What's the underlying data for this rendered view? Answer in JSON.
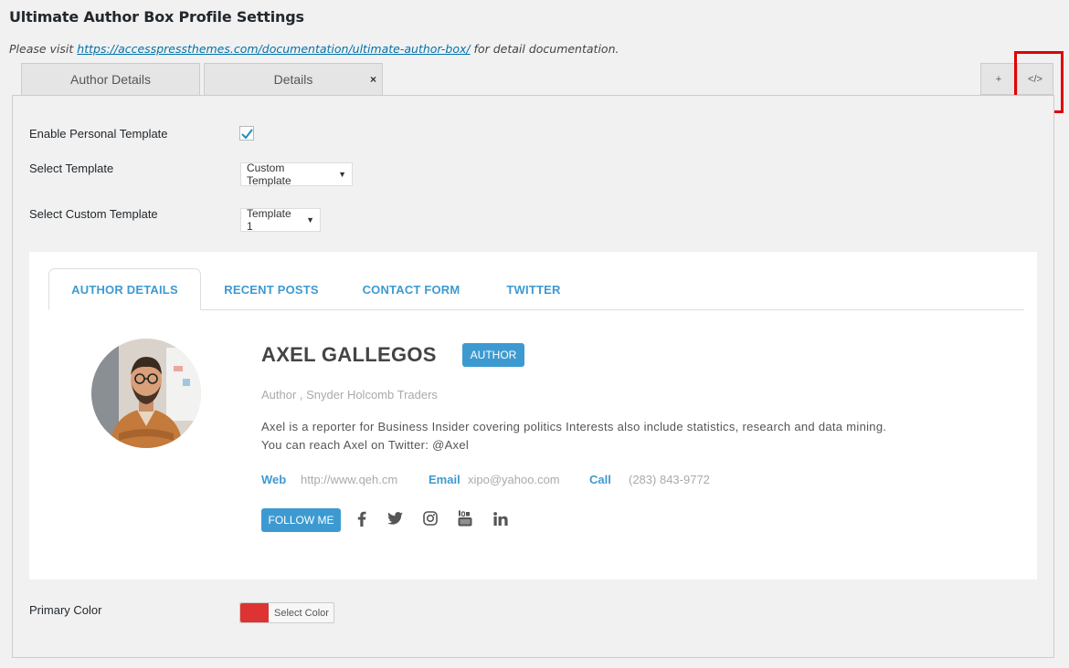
{
  "page": {
    "title": "Ultimate Author Box Profile Settings",
    "note_prefix": "Please visit ",
    "note_link": "https://accesspressthemes.com/documentation/ultimate-author-box/",
    "note_suffix": " for detail documentation."
  },
  "top_tabs": {
    "author_details": "Author Details",
    "details": "Details",
    "close": "×",
    "add": "+",
    "code": "</>"
  },
  "form": {
    "enable_personal_label": "Enable Personal Template",
    "enable_personal_checked": true,
    "select_template_label": "Select Template",
    "select_template_value": "Custom Template",
    "select_custom_label": "Select Custom Template",
    "select_custom_value": "Template 1",
    "primary_color_label": "Primary Color",
    "primary_color_button": "Select Color",
    "primary_color_value": "#dd3333"
  },
  "preview": {
    "tabs": [
      "AUTHOR DETAILS",
      "RECENT POSTS",
      "CONTACT FORM",
      "TWITTER"
    ],
    "name": "AXEL GALLEGOS",
    "role": "AUTHOR",
    "subtitle": "Author , Snyder Holcomb Traders",
    "bio_line1": "Axel is a reporter for Business Insider covering politics Interests also include statistics, research and data mining.",
    "bio_line2": "You can reach Axel on Twitter: @Axel",
    "web_label": "Web",
    "web_value": "http://www.qeh.cm",
    "email_label": "Email",
    "email_value": "xipo@yahoo.com",
    "call_label": "Call",
    "call_value": "(283) 843-9772",
    "follow_label": "FOLLOW ME",
    "social_icons": [
      "facebook-icon",
      "twitter-icon",
      "instagram-icon",
      "youtube-icon",
      "linkedin-icon"
    ],
    "accent_color": "#3d9ad1"
  }
}
